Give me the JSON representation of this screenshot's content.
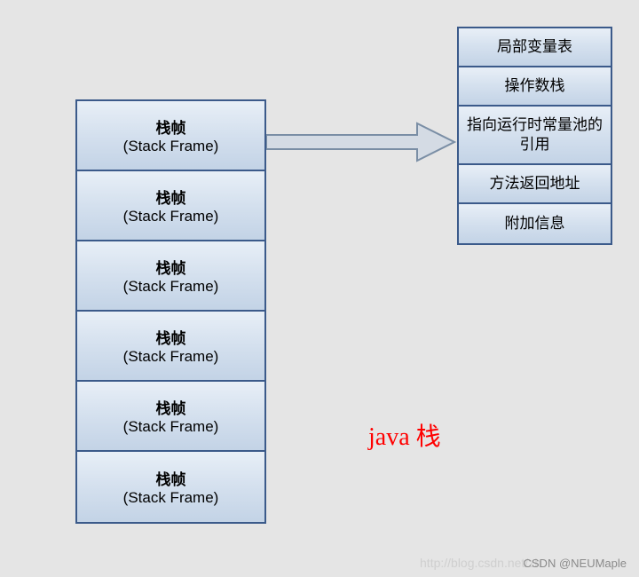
{
  "stackFrames": [
    {
      "zh": "栈帧",
      "en": "(Stack  Frame)"
    },
    {
      "zh": "栈帧",
      "en": "(Stack Frame)"
    },
    {
      "zh": "栈帧",
      "en": "(Stack Frame)"
    },
    {
      "zh": "栈帧",
      "en": "(Stack Frame)"
    },
    {
      "zh": "栈帧",
      "en": "(Stack Frame)"
    },
    {
      "zh": "栈帧",
      "en": "(Stack Frame)"
    }
  ],
  "frameDetails": [
    "局部变量表",
    "操作数栈",
    "指向运行时常量池的引用",
    "方法返回地址",
    "附加信息"
  ],
  "caption": "java 栈",
  "watermark_blog": "http://blog.csdn.net/zh",
  "watermark_csdn": "CSDN @NEUMaple",
  "arrow": {
    "stroke": "#7a8ea5",
    "fill": "#d4dbe4"
  }
}
